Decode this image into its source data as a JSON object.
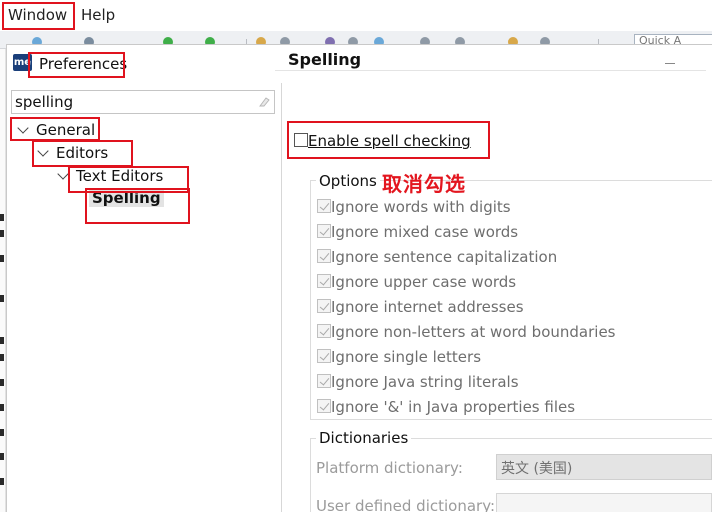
{
  "menubar": {
    "window": "Window",
    "help": "Help",
    "quick_access": "Quick A"
  },
  "dialog": {
    "title": "Preferences",
    "app_icon_text": "me"
  },
  "tree": {
    "filter_value": "spelling",
    "items": [
      "General",
      "Editors",
      "Text Editors",
      "Spelling"
    ]
  },
  "content": {
    "title": "Spelling",
    "enable_label": "Enable spell checking",
    "options_legend": "Options",
    "options": [
      "Ignore words with digits",
      "Ignore mixed case words",
      "Ignore sentence capitalization",
      "Ignore upper case words",
      "Ignore internet addresses",
      "Ignore non-letters at word boundaries",
      "Ignore single letters",
      "Ignore Java string literals",
      "Ignore '&' in Java properties files"
    ],
    "dictionaries_legend": "Dictionaries",
    "platform_label": "Platform dictionary:",
    "platform_value": "英文 (美国)",
    "user_label": "User defined dictionary:"
  },
  "annotation": {
    "text": "取消勾选"
  },
  "colors": {
    "annotation_red": "#e0131e",
    "selection_bg": "#e3e3e3"
  }
}
